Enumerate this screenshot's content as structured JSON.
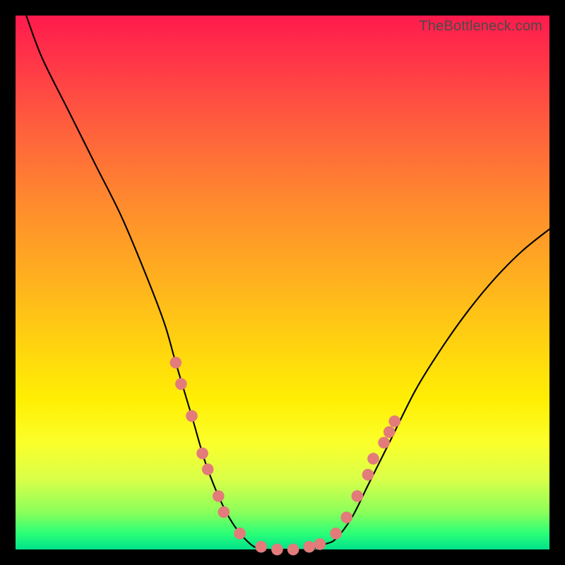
{
  "attribution": "TheBottleneck.com",
  "colors": {
    "frame": "#000000",
    "gradient_top": "#ff1a4d",
    "gradient_mid": "#ffd40f",
    "gradient_bottom": "#00e28a",
    "curve": "#000000",
    "markers": "#e37b7b"
  },
  "chart_data": {
    "type": "line",
    "title": "",
    "xlabel": "",
    "ylabel": "",
    "xlim": [
      0,
      100
    ],
    "ylim": [
      0,
      100
    ],
    "note": "No numeric axis ticks or gridlines are rendered; values are pixel-proportional estimates (0–100 normalized).",
    "series": [
      {
        "name": "bottleneck-curve",
        "x": [
          2,
          5,
          10,
          15,
          20,
          25,
          28,
          30,
          33,
          36,
          40,
          44,
          47,
          50,
          52,
          55,
          58,
          60,
          63,
          66,
          70,
          75,
          80,
          85,
          90,
          95,
          100
        ],
        "y": [
          100,
          92,
          82,
          72,
          62,
          50,
          42,
          35,
          25,
          15,
          6,
          1,
          0,
          0,
          0,
          0,
          1,
          2,
          6,
          12,
          20,
          30,
          38,
          45,
          51,
          56,
          60
        ]
      }
    ],
    "markers": {
      "name": "highlight-points",
      "note": "Pink circular markers clustered on both flanks near the curve bottom.",
      "points": [
        {
          "x": 30,
          "y": 35
        },
        {
          "x": 31,
          "y": 31
        },
        {
          "x": 33,
          "y": 25
        },
        {
          "x": 35,
          "y": 18
        },
        {
          "x": 36,
          "y": 15
        },
        {
          "x": 38,
          "y": 10
        },
        {
          "x": 39,
          "y": 7
        },
        {
          "x": 42,
          "y": 3
        },
        {
          "x": 46,
          "y": 0.5
        },
        {
          "x": 49,
          "y": 0
        },
        {
          "x": 52,
          "y": 0
        },
        {
          "x": 55,
          "y": 0.5
        },
        {
          "x": 57,
          "y": 1
        },
        {
          "x": 60,
          "y": 3
        },
        {
          "x": 62,
          "y": 6
        },
        {
          "x": 64,
          "y": 10
        },
        {
          "x": 66,
          "y": 14
        },
        {
          "x": 67,
          "y": 17
        },
        {
          "x": 69,
          "y": 20
        },
        {
          "x": 70,
          "y": 22
        },
        {
          "x": 71,
          "y": 24
        }
      ]
    }
  }
}
